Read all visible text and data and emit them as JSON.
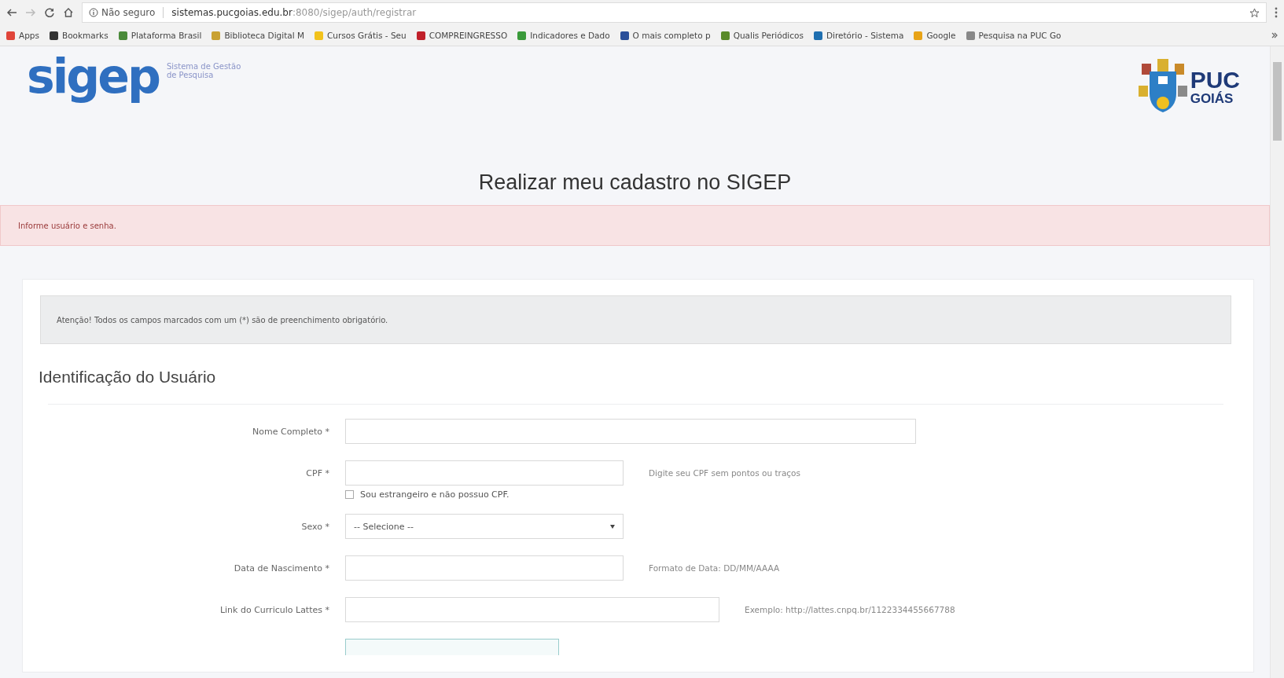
{
  "browser": {
    "security": "Não seguro",
    "url_host": "sistemas.pucgoias.edu.br",
    "url_path": ":8080/sigep/auth/registrar"
  },
  "bookmarks": [
    {
      "label": "Apps",
      "color": "#e0453a"
    },
    {
      "label": "Bookmarks",
      "color": "#333333"
    },
    {
      "label": "Plataforma Brasil",
      "color": "#4a8a3a"
    },
    {
      "label": "Biblioteca Digital M",
      "color": "#c9a233"
    },
    {
      "label": "Cursos Grátis - Seu",
      "color": "#f2c21b"
    },
    {
      "label": "COMPREINGRESSO",
      "color": "#c0202a"
    },
    {
      "label": "Indicadores e Dado",
      "color": "#3a9a3a"
    },
    {
      "label": "O mais completo p",
      "color": "#2a4f9a"
    },
    {
      "label": "Qualis Periódicos",
      "color": "#5a8a2a"
    },
    {
      "label": "Diretório - Sistema",
      "color": "#1f6fb0"
    },
    {
      "label": "Google",
      "color": "#e8a317"
    },
    {
      "label": "Pesquisa na PUC Go",
      "color": "#888888"
    }
  ],
  "header": {
    "logo": "sigep",
    "tagline_1": "Sistema de Gestão",
    "tagline_2": "de Pesquisa",
    "partner_logo_1": "PUC",
    "partner_logo_2": "GOIÁS"
  },
  "page_title": "Realizar meu cadastro no SIGEP",
  "error_message": "Informe usuário e senha.",
  "notice": "Atenção! Todos os campos marcados com um (*) são de preenchimento obrigatório.",
  "section_title": "Identificação do Usuário",
  "fields": [
    {
      "kind": "text",
      "label": "Nome Completo *"
    },
    {
      "kind": "text",
      "label": "CPF *",
      "hint": "Digite seu CPF sem pontos ou traços"
    },
    {
      "kind": "checkbox",
      "label": "Sou estrangeiro e não possuo CPF.",
      "checked": false
    },
    {
      "kind": "select",
      "label": "Sexo *",
      "value": "-- Selecione --"
    },
    {
      "kind": "text",
      "label": "Data de Nascimento *",
      "hint": "Formato de Data: DD/MM/AAAA"
    },
    {
      "kind": "text",
      "label": "Link do Curriculo Lattes *",
      "hint": "Exemplo: http://lattes.cnpq.br/1122334455667788"
    }
  ]
}
